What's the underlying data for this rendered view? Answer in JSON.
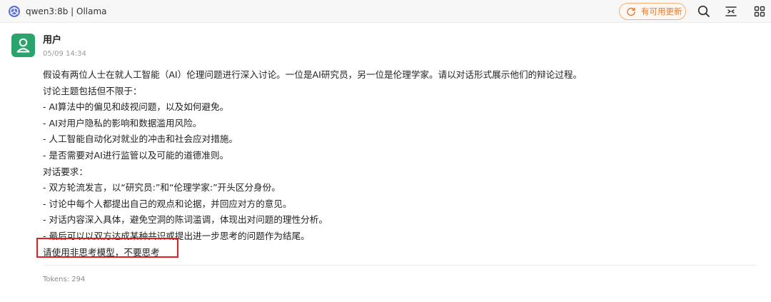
{
  "header": {
    "title": "qwen3:8b | Ollama",
    "update_label": "有可用更新",
    "icons": [
      "app-logo-icon",
      "refresh-icon",
      "search-icon",
      "expand-icon",
      "grid-icon"
    ],
    "accent": "#e07a32"
  },
  "message": {
    "author": "用户",
    "timestamp": "05/09 14:34",
    "avatar_icon": "user-icon",
    "avatar_color": "#2ba36c",
    "lines": [
      "假设有两位人士在就人工智能（AI）伦理问题进行深入讨论。一位是AI研究员，另一位是伦理学家。请以对话形式展示他们的辩论过程。",
      "讨论主题包括但不限于：",
      "- AI算法中的偏见和歧视问题，以及如何避免。",
      "- AI对用户隐私的影响和数据滥用风险。",
      "- 人工智能自动化对就业的冲击和社会应对措施。",
      "- 是否需要对AI进行监管以及可能的道德准则。",
      "对话要求：",
      "- 双方轮流发言，以“研究员:”和“伦理学家:”开头区分身份。",
      "- 讨论中每个人都提出自己的观点和论据，并回应对方的意见。",
      "- 对话内容深入具体，避免空洞的陈词滥调，体现出对问题的理性分析。",
      "- 最后可以以双方达成某种共识或提出进一步思考的问题作为结尾。",
      "请使用非思考模型，不要思考"
    ],
    "highlight_color": "#e02020",
    "tokens": "Tokens: 294"
  }
}
